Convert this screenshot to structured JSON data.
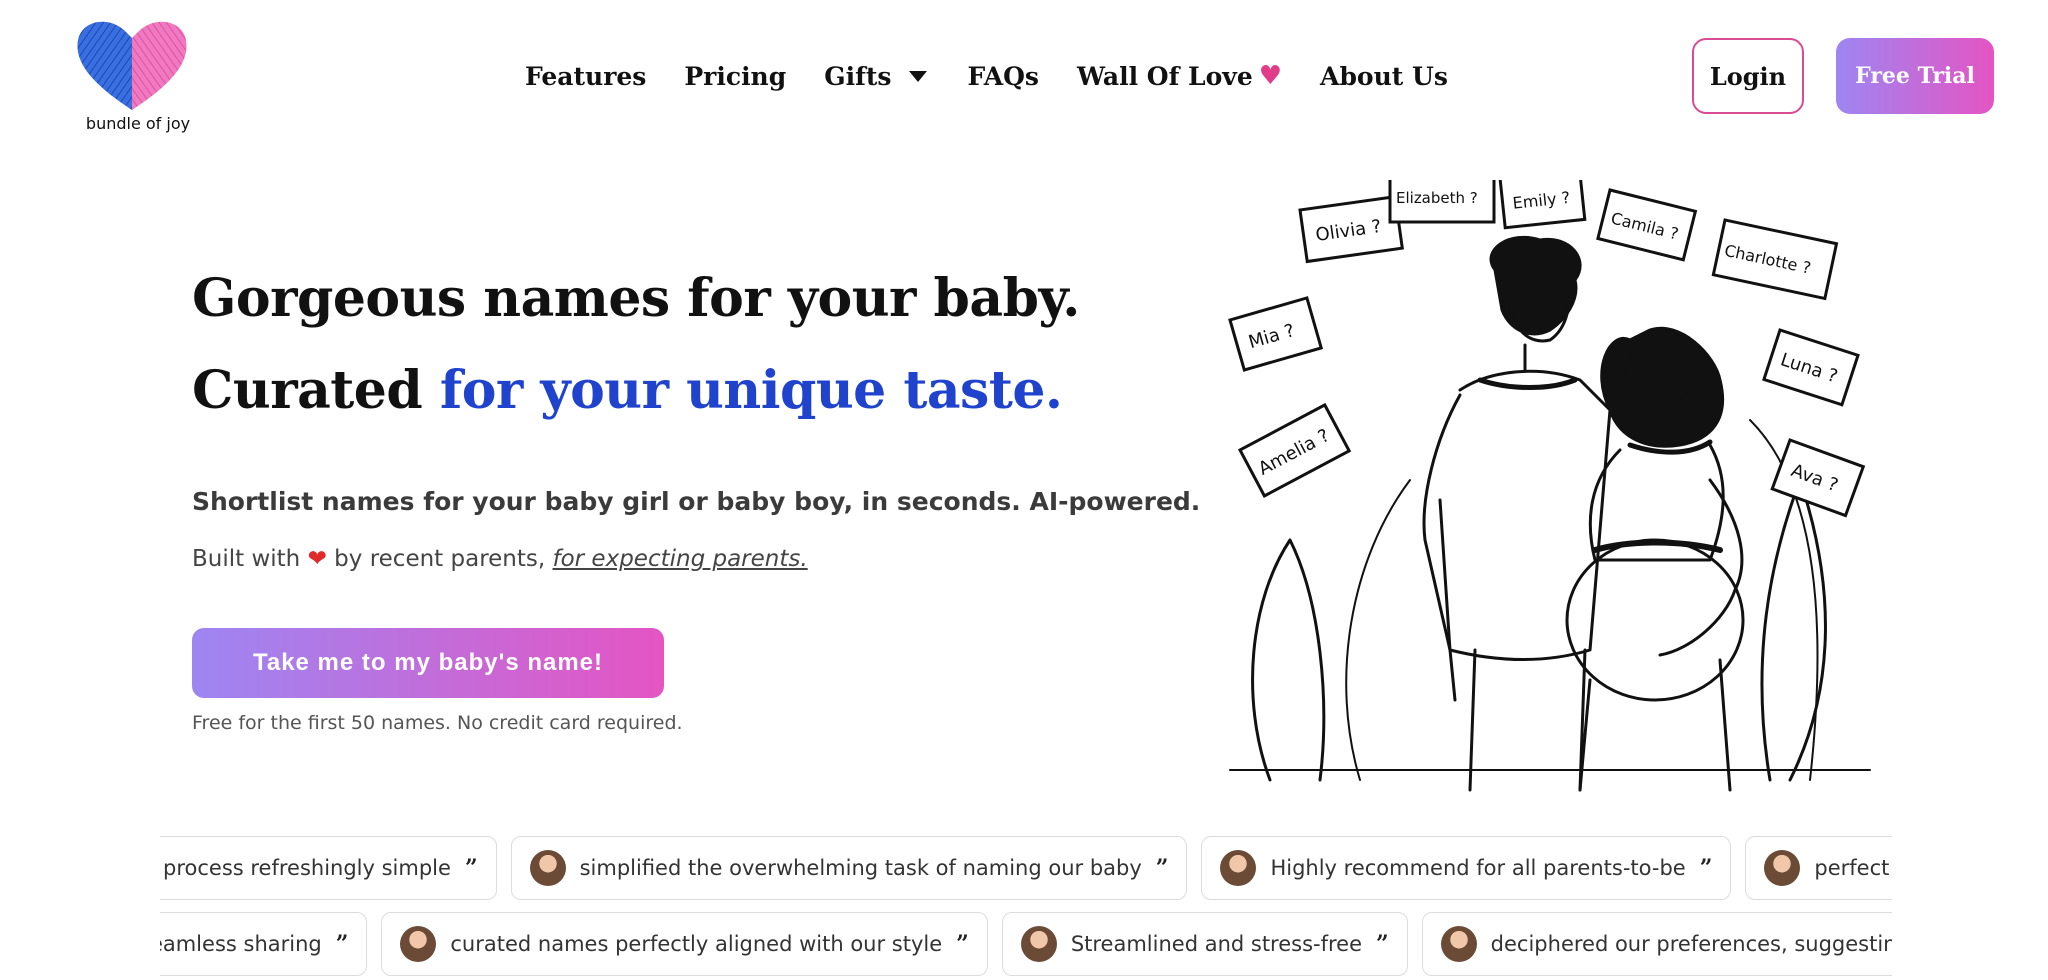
{
  "header": {
    "logo_text": "bundle of joy",
    "nav": [
      {
        "label": "Features"
      },
      {
        "label": "Pricing"
      },
      {
        "label": "Gifts"
      },
      {
        "label": "FAQs"
      },
      {
        "label": "Wall Of Love"
      },
      {
        "label": "About Us"
      }
    ],
    "login_label": "Login",
    "trial_label": "Free Trial"
  },
  "hero": {
    "title_line1": "Gorgeous names for your baby.",
    "title_line2_prefix": "Curated ",
    "title_line2_accent": "for your unique taste.",
    "subtitle": "Shortlist names for your baby girl or baby boy, in seconds. AI-powered.",
    "built_prefix": "Built with ",
    "built_middle": " by recent parents, ",
    "built_link": "for expecting parents.",
    "cta_label": "Take me to my baby's name!",
    "note": "Free for the first 50 names. No credit card required."
  },
  "illustration": {
    "bubbles": [
      "Olivia ?",
      "Elizabeth ?",
      "Emily ?",
      "Camila ?",
      "Charlotte ?",
      "Mia ?",
      "Luna ?",
      "Amelia ?",
      "Ava ?"
    ]
  },
  "testimonials": {
    "row1": [
      {
        "text": "process refreshingly simple",
        "avatar": false
      },
      {
        "text": "simplified the overwhelming task of naming our baby",
        "avatar": true
      },
      {
        "text": "Highly recommend for all parents-to-be",
        "avatar": true
      },
      {
        "text": "perfect name stress-free",
        "avatar": true
      }
    ],
    "row2": [
      {
        "text": "seamless sharing",
        "avatar": false
      },
      {
        "text": "curated names perfectly aligned with our style",
        "avatar": true
      },
      {
        "text": "Streamlined and stress-free",
        "avatar": true
      },
      {
        "text": "deciphered our preferences, suggesting names that fit",
        "avatar": true
      }
    ]
  },
  "colors": {
    "accent_blue": "#1f43cc",
    "gradient_start": "#9d86f2",
    "gradient_end": "#e455c3",
    "login_border": "#d94c94"
  }
}
